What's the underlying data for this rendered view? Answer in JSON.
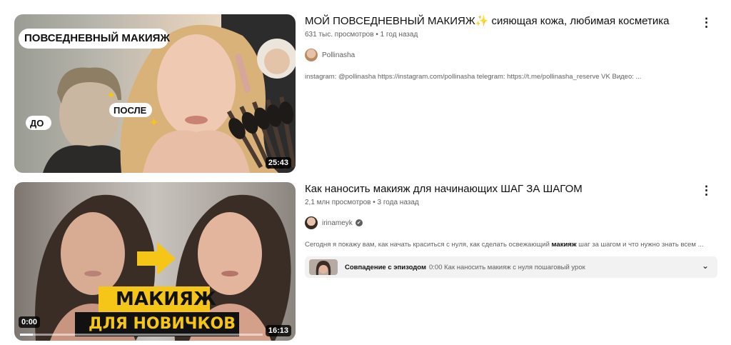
{
  "results": [
    {
      "title": "МОЙ ПОВСЕДНЕВНЫЙ МАКИЯЖ✨ сияющая кожа, любимая косметика",
      "meta": "631 тыс. просмотров • 1 год назад",
      "channel": "Pollinasha",
      "description": "instagram: @pollinasha https://instagram.com/pollinasha telegram: https://t.me/pollinasha_reserve VK Видео: ...",
      "duration": "25:43",
      "thumb_text": {
        "banner": "ПОВСЕДНЕВНЫЙ МАКИЯЖ",
        "before": "ДО",
        "after": "ПОСЛЕ"
      }
    },
    {
      "title": "Как наносить макияж для начинающих ШАГ ЗА ШАГОМ",
      "meta": "2,1 млн просмотров • 3 года назад",
      "channel": "irinameyk",
      "description_before": "Сегодня я покажу вам, как начать краситься с нуля, как сделать освежающий ",
      "description_bold": "макияж",
      "description_after": " шаг за шагом и что нужно знать всем ...",
      "duration": "16:13",
      "time_progress": "0:00",
      "thumb_text": {
        "line1": "МАКИЯЖ",
        "line2": "ДЛЯ НОВИЧКОВ"
      },
      "chapter": {
        "label": "Совпадение с эпизодом",
        "detail": "0:00 Как наносить макияж с нуля пошаговый урок"
      }
    }
  ],
  "icons": {
    "more": "⋮",
    "chevron": "⌄",
    "verified": "✔",
    "sparkle": "✦"
  },
  "colors": {
    "accent_yellow": "#f5c518",
    "text_primary": "#0f0f0f",
    "text_secondary": "#606060"
  }
}
